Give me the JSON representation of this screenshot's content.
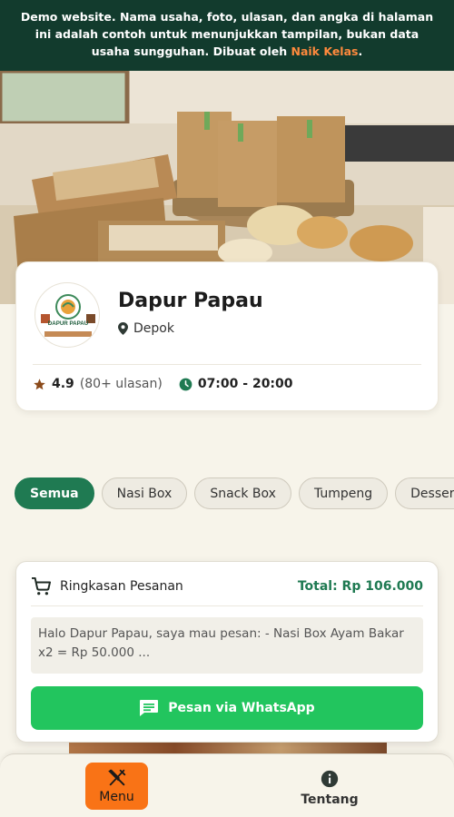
{
  "banner": {
    "text": "Demo website. Nama usaha, foto, ulasan, dan angka di halaman ini adalah contoh untuk menunjukkan tampilan, bukan data usaha sungguhan. Dibuat oleh ",
    "link_text": "Naik Kelas",
    "suffix": "."
  },
  "business": {
    "name": "Dapur Papau",
    "location": "Depok",
    "rating": "4.9",
    "reviews": "(80+ ulasan)",
    "hours": "07:00 - 20:00",
    "logo_text": "DAPUR PAPAU"
  },
  "categories": [
    {
      "label": "Semua",
      "active": true
    },
    {
      "label": "Nasi Box",
      "active": false
    },
    {
      "label": "Snack Box",
      "active": false
    },
    {
      "label": "Tumpeng",
      "active": false
    },
    {
      "label": "Dessert",
      "active": false
    }
  ],
  "order_summary": {
    "title": "Ringkasan Pesanan",
    "total": "Total: Rp 106.000",
    "message": "Halo Dapur Papau, saya mau pesan: - Nasi Box Ayam Bakar x2 = Rp 50.000 ...",
    "button_label": "Pesan via WhatsApp"
  },
  "bottom_nav": {
    "menu_label": "Menu",
    "about_label": "Tentang"
  },
  "colors": {
    "banner_bg": "#123b2d",
    "brand_green": "#1f7a52",
    "whatsapp_green": "#22c55e",
    "accent_orange": "#f97316",
    "link_orange": "#ff8a3d"
  },
  "icons": {
    "location": "map-pin-icon",
    "rating": "star-icon",
    "hours": "clock-icon",
    "cart": "shopping-cart-icon",
    "chat": "message-icon",
    "menu": "utensils-icon",
    "about": "info-icon"
  }
}
